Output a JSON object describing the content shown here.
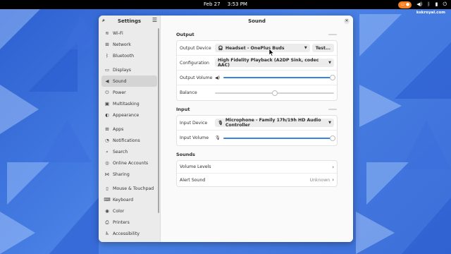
{
  "topbar": {
    "date": "Feb 27",
    "time": "3:53 PM",
    "tray_icons": [
      "screencast-icon",
      "volume-icon",
      "bluetooth-icon",
      "battery-icon",
      "power-icon"
    ]
  },
  "watermark": "kskroyal.com",
  "sidebar": {
    "title": "Settings",
    "items": [
      {
        "label": "Wi-Fi",
        "icon": "wifi-icon",
        "glyph": "≋"
      },
      {
        "label": "Network",
        "icon": "network-icon",
        "glyph": "⊞"
      },
      {
        "label": "Bluetooth",
        "icon": "bluetooth-icon",
        "glyph": "ᛒ"
      },
      {
        "label": "Displays",
        "icon": "display-icon",
        "glyph": "▭"
      },
      {
        "label": "Sound",
        "icon": "speaker-icon",
        "glyph": "◀"
      },
      {
        "label": "Power",
        "icon": "power-icon",
        "glyph": "⏻"
      },
      {
        "label": "Multitasking",
        "icon": "multitasking-icon",
        "glyph": "▣"
      },
      {
        "label": "Appearance",
        "icon": "appearance-icon",
        "glyph": "◐"
      },
      {
        "label": "Apps",
        "icon": "apps-icon",
        "glyph": "⊞"
      },
      {
        "label": "Notifications",
        "icon": "bell-icon",
        "glyph": "◔"
      },
      {
        "label": "Search",
        "icon": "search-icon",
        "glyph": "⌕"
      },
      {
        "label": "Online Accounts",
        "icon": "accounts-icon",
        "glyph": "◎"
      },
      {
        "label": "Sharing",
        "icon": "sharing-icon",
        "glyph": "⋈"
      },
      {
        "label": "Mouse & Touchpad",
        "icon": "mouse-icon",
        "glyph": "▯"
      },
      {
        "label": "Keyboard",
        "icon": "keyboard-icon",
        "glyph": "⌨"
      },
      {
        "label": "Color",
        "icon": "color-icon",
        "glyph": "◉"
      },
      {
        "label": "Printers",
        "icon": "printer-icon",
        "glyph": "⎙"
      },
      {
        "label": "Accessibility",
        "icon": "accessibility-icon",
        "glyph": "♿"
      }
    ],
    "active_index": 4
  },
  "main": {
    "title": "Sound",
    "output": {
      "title": "Output",
      "device_label": "Output Device",
      "device_value": "Headset - OnePlus Buds",
      "test_label": "Test...",
      "config_label": "Configuration",
      "config_value": "High Fidelity Playback (A2DP Sink, codec AAC)",
      "volume_label": "Output Volume",
      "volume_level": 0.99,
      "balance_label": "Balance",
      "balance_level": 0.5
    },
    "input": {
      "title": "Input",
      "device_label": "Input Device",
      "device_value": "Microphone - Family 17h/19h HD Audio Controller",
      "volume_label": "Input Volume",
      "volume_level": 0.99
    },
    "sounds": {
      "title": "Sounds",
      "volume_levels_label": "Volume Levels",
      "alert_sound_label": "Alert Sound",
      "alert_sound_value": "Unknown"
    }
  },
  "colors": {
    "accent": "#3584e4",
    "tray_accent": "#f57e1f"
  }
}
